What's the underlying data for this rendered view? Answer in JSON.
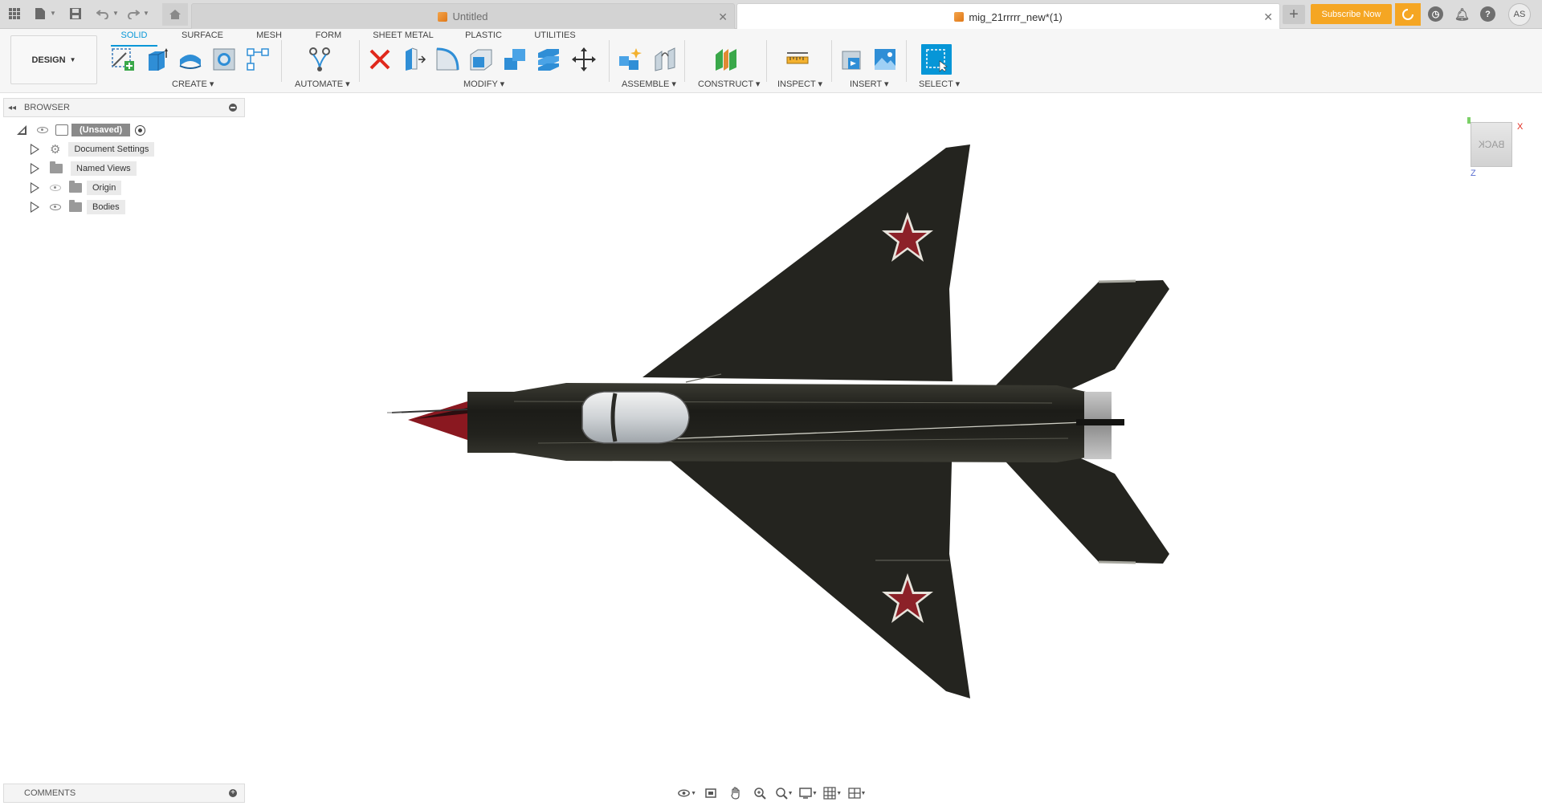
{
  "tabbar": {
    "tabs": [
      {
        "label": "Untitled",
        "active": false
      },
      {
        "label": "mig_21rrrrr_new*(1)",
        "active": true
      }
    ],
    "subscribe_label": "Subscribe Now",
    "avatar_initials": "AS"
  },
  "toolbar": {
    "workspace_label": "DESIGN",
    "tabs": [
      "SOLID",
      "SURFACE",
      "MESH",
      "FORM",
      "SHEET METAL",
      "PLASTIC",
      "UTILITIES"
    ],
    "active_tab": "SOLID",
    "groups": [
      "CREATE",
      "AUTOMATE",
      "MODIFY",
      "ASSEMBLE",
      "CONSTRUCT",
      "INSPECT",
      "INSERT",
      "SELECT"
    ]
  },
  "browser": {
    "title": "BROWSER",
    "root_label": "(Unsaved)",
    "items": [
      {
        "label": "Document Settings",
        "icon": "gear-icon"
      },
      {
        "label": "Named Views",
        "icon": "folder-icon"
      },
      {
        "label": "Origin",
        "icon": "folder-icon"
      },
      {
        "label": "Bodies",
        "icon": "folder-icon"
      }
    ]
  },
  "comments": {
    "title": "COMMENTS"
  },
  "viewcube": {
    "face_label": "BACK",
    "axis_x": "X",
    "axis_z": "Z"
  },
  "colors": {
    "accent": "#0696d7",
    "subscribe": "#f5a623",
    "aircraft_body": "#252520",
    "star": "#8c2128"
  }
}
